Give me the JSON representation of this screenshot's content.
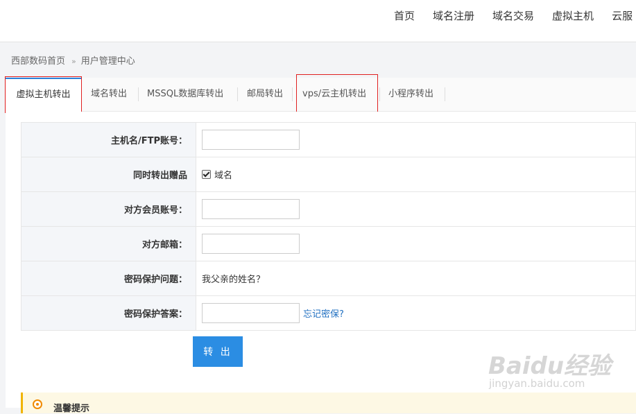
{
  "top_nav": [
    "首页",
    "域名注册",
    "域名交易",
    "虚拟主机",
    "云服"
  ],
  "breadcrumb": {
    "home": "西部数码首页",
    "separator": "»",
    "current": "用户管理中心"
  },
  "tabs": [
    "虚拟主机转出",
    "域名转出",
    "MSSQL数据库转出",
    "邮局转出",
    "vps/云主机转出",
    "小程序转出"
  ],
  "active_tab": "虚拟主机转出",
  "form": {
    "host_label": "主机名/FTP账号：",
    "host_value": "",
    "gift_label": "同时转出赠品",
    "gift_option": "域名",
    "gift_checked": true,
    "member_label": "对方会员账号：",
    "member_value": "",
    "email_label": "对方邮箱：",
    "email_value": "",
    "question_label": "密码保护问题：",
    "question_value": "我父亲的姓名？",
    "answer_label": "密码保护答案：",
    "answer_value": "",
    "forgot_link": "忘记密保?",
    "submit_label": "转 出"
  },
  "tip": {
    "title": "温馨提示"
  },
  "watermark": {
    "main": "Baidu经验",
    "sub": "jingyan.baidu.com"
  },
  "colors": {
    "accent": "#2b8de3",
    "tab_highlight": "#2b83dc",
    "annotation": "#e02020",
    "link": "#2170c1"
  }
}
